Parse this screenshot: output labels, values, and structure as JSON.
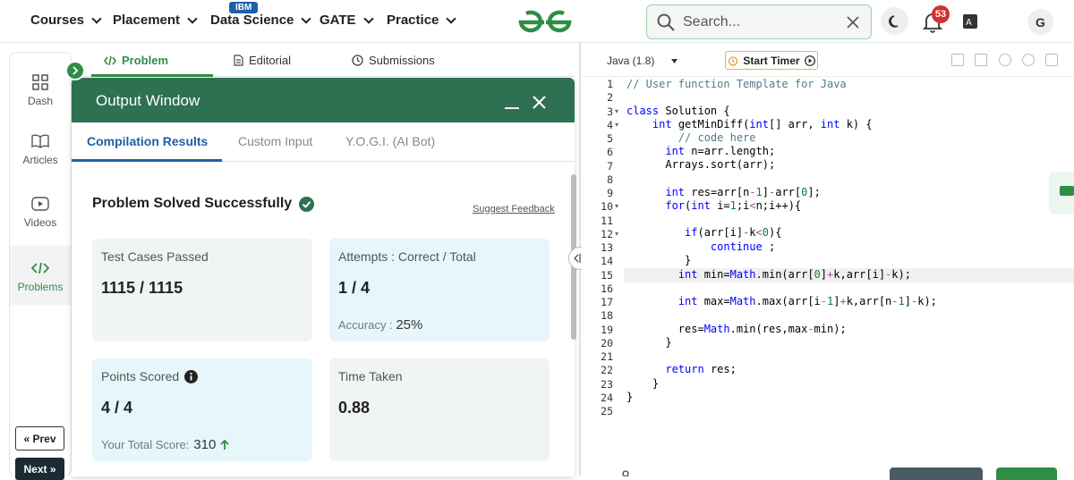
{
  "nav": {
    "items": [
      {
        "label": "Courses"
      },
      {
        "label": "Placement"
      },
      {
        "label": "Data Science"
      },
      {
        "label": "GATE"
      },
      {
        "label": "Practice"
      }
    ],
    "ibm_badge": "IBM",
    "search_placeholder": "Search...",
    "notification_count": "53",
    "avatar_letter": "G"
  },
  "rail": {
    "items": [
      {
        "label": "Dash",
        "icon": "dashboard-icon"
      },
      {
        "label": "Articles",
        "icon": "book-icon"
      },
      {
        "label": "Videos",
        "icon": "video-icon"
      },
      {
        "label": "Problems",
        "icon": "code-icon"
      }
    ],
    "prev_label": "« Prev",
    "next_label": "Next »"
  },
  "problem_tabs": [
    {
      "label": "Problem",
      "icon": "code-icon"
    },
    {
      "label": "Editorial",
      "icon": "document-icon"
    },
    {
      "label": "Submissions",
      "icon": "clock-icon"
    }
  ],
  "output": {
    "title": "Output Window",
    "tabs": [
      "Compilation Results",
      "Custom Input",
      "Y.O.G.I. (AI Bot)"
    ],
    "status": "Problem Solved Successfully",
    "suggest_feedback": "Suggest Feedback",
    "cards": {
      "test_cases": {
        "label": "Test Cases Passed",
        "value": "1115 / 1115"
      },
      "attempts": {
        "label": "Attempts : Correct / Total",
        "value": "1 / 4",
        "accuracy_label": "Accuracy :",
        "accuracy_value": "25%"
      },
      "points": {
        "label": "Points Scored",
        "value": "4 / 4",
        "total_label": "Your Total Score:",
        "total_value": "310"
      },
      "time": {
        "label": "Time Taken",
        "value": "0.88"
      }
    }
  },
  "editor": {
    "language": "Java (1.8)",
    "timer_label": "Start Timer",
    "line_numbers": [
      "1",
      "2",
      "3",
      "4",
      "5",
      "6",
      "7",
      "8",
      "9",
      "10",
      "11",
      "12",
      "13",
      "14",
      "15",
      "16",
      "17",
      "18",
      "19",
      "20",
      "21",
      "22",
      "23",
      "24",
      "25"
    ]
  },
  "colors": {
    "brand_green": "#2f8d46",
    "header_green": "#2e7152",
    "link_blue": "#1f5fa6"
  }
}
